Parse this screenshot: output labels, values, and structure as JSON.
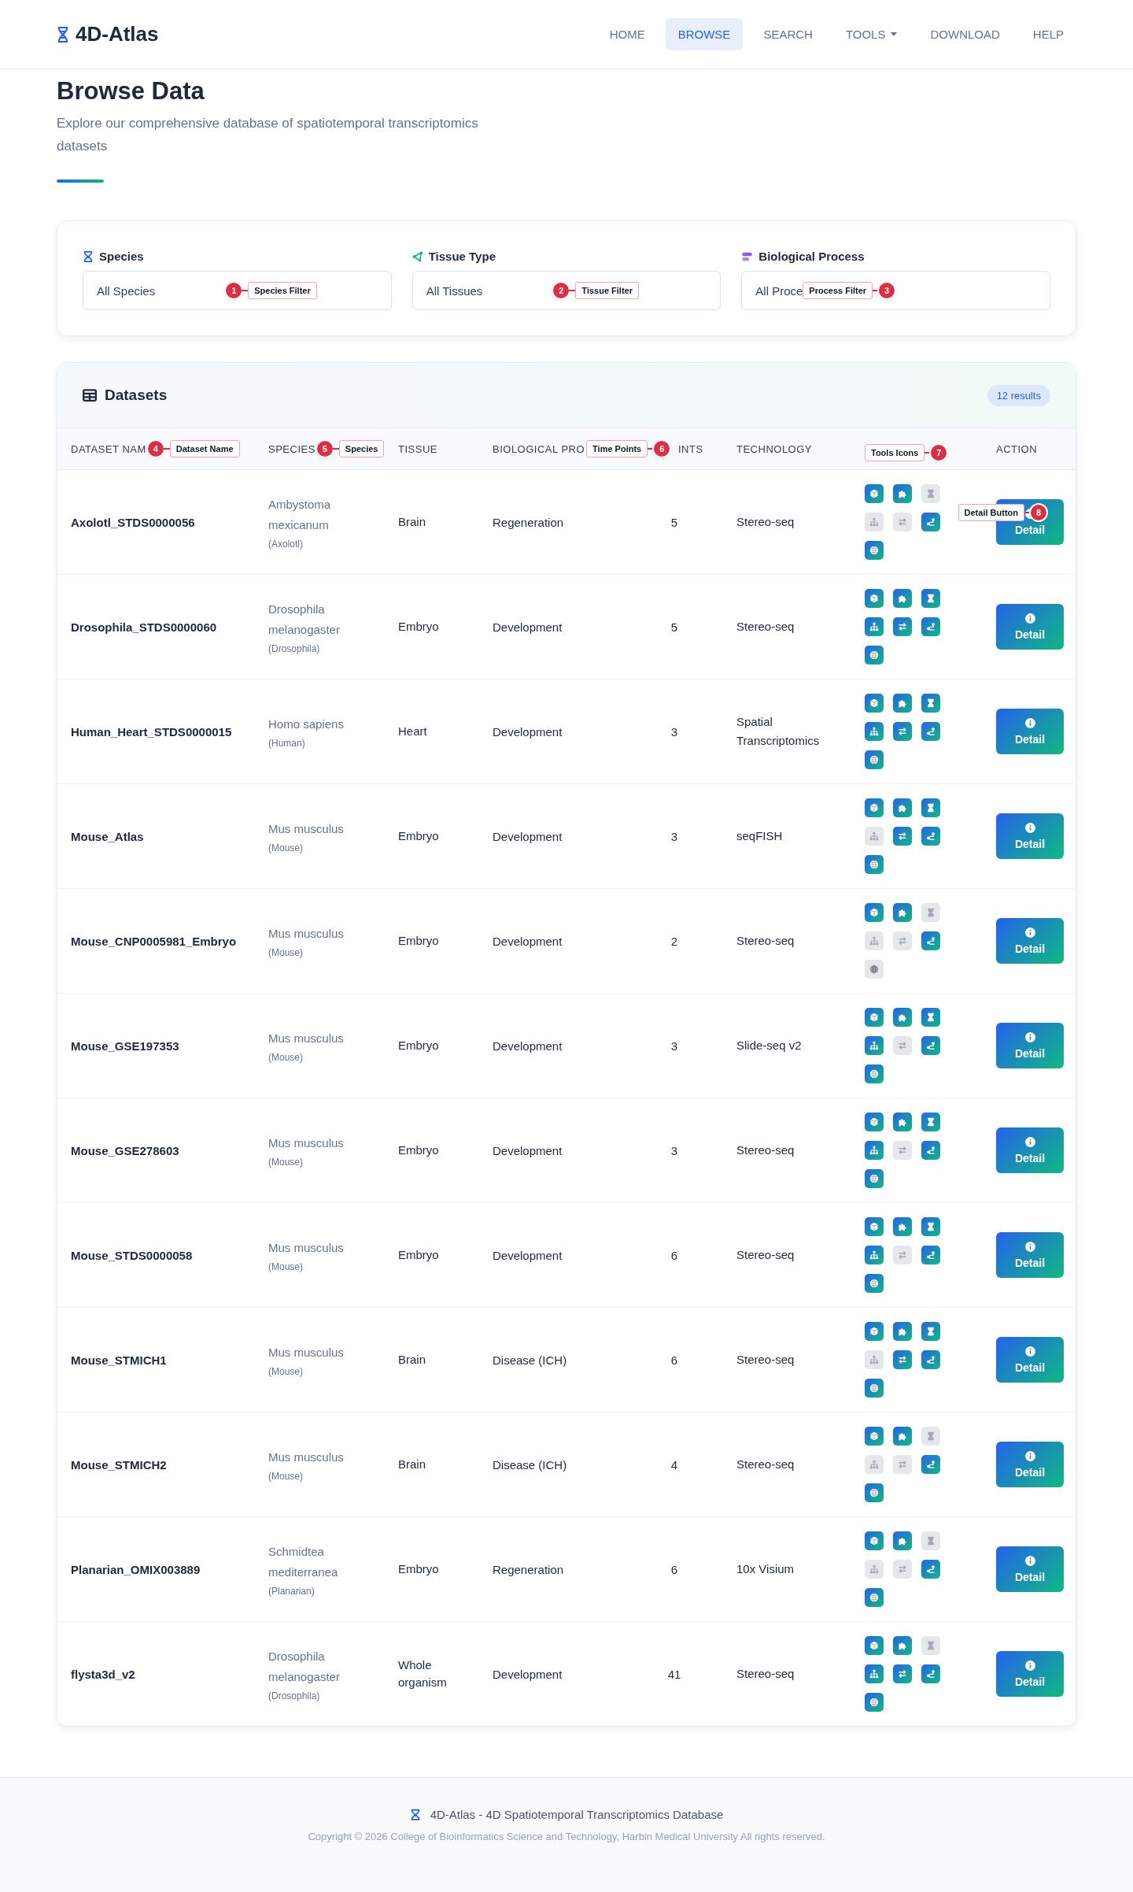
{
  "brand": "4D-Atlas",
  "nav": [
    {
      "label": "HOME",
      "selected": false,
      "dropdown": false
    },
    {
      "label": "BROWSE",
      "selected": true,
      "dropdown": false
    },
    {
      "label": "SEARCH",
      "selected": false,
      "dropdown": false
    },
    {
      "label": "TOOLS",
      "selected": false,
      "dropdown": true
    },
    {
      "label": "DOWNLOAD",
      "selected": false,
      "dropdown": false
    },
    {
      "label": "HELP",
      "selected": false,
      "dropdown": false
    }
  ],
  "page": {
    "title": "Browse Data",
    "subtitle": "Explore our comprehensive database of spatiotemporal transcriptomics datasets"
  },
  "filters": [
    {
      "label": "Species",
      "value": "All Species",
      "callout": {
        "number": "1",
        "label": "Species Filter",
        "kind": "badge-first"
      }
    },
    {
      "label": "Tissue Type",
      "value": "All Tissues",
      "callout": {
        "number": "2",
        "label": "Tissue Filter",
        "kind": "badge-first"
      }
    },
    {
      "label": "Biological Process",
      "value": "All Proce",
      "callout": {
        "number": "3",
        "label": "Process Filter",
        "kind": "label-first"
      }
    }
  ],
  "datasets": {
    "title": "Datasets",
    "count": "12 results",
    "columns": [
      {
        "label": "DATASET NAM",
        "callout": {
          "number": "4",
          "label": "Dataset Name",
          "kind": "badge-first"
        }
      },
      {
        "label": "SPECIES",
        "callout": {
          "number": "5",
          "label": "Species",
          "kind": "badge-first"
        }
      },
      {
        "label": "TISSUE"
      },
      {
        "label": "BIOLOGICAL PRO",
        "callout": {
          "number": "6",
          "label": "Time Points",
          "kind": "label-first"
        }
      },
      {
        "label": "INTS"
      },
      {
        "label": "TECHNOLOGY"
      },
      {
        "callout": {
          "number": "7",
          "label": "Tools Icons",
          "kind": "label-first"
        }
      },
      {
        "label": "ACTION"
      }
    ],
    "rows": [
      {
        "name": "Axolotl_STDS0000056",
        "species": "Ambystoma mexicanum",
        "common": "(Axolotl)",
        "tissue": "Brain",
        "process": "Regeneration",
        "time_points": "5",
        "technology": "Stereo-seq",
        "tools": [
          true,
          true,
          false,
          false,
          false,
          true,
          true
        ],
        "action": "Detail",
        "callout": {
          "number": "8",
          "label": "Detail Button",
          "kind": "label-first"
        }
      },
      {
        "name": "Drosophila_STDS0000060",
        "species": "Drosophila melanogaster",
        "common": "(Drosophila)",
        "tissue": "Embryo",
        "process": "Development",
        "time_points": "5",
        "technology": "Stereo-seq",
        "tools": [
          true,
          true,
          true,
          true,
          true,
          true,
          true
        ],
        "action": "Detail"
      },
      {
        "name": "Human_Heart_STDS0000015",
        "species": "Homo sapiens",
        "common": "(Human)",
        "tissue": "Heart",
        "process": "Development",
        "time_points": "3",
        "technology": "Spatial Transcriptomics",
        "tools": [
          true,
          true,
          true,
          true,
          true,
          true,
          true
        ],
        "action": "Detail"
      },
      {
        "name": "Mouse_Atlas",
        "species": "Mus musculus",
        "common": "(Mouse)",
        "tissue": "Embryo",
        "process": "Development",
        "time_points": "3",
        "technology": "seqFISH",
        "tools": [
          true,
          true,
          true,
          false,
          true,
          true,
          true
        ],
        "action": "Detail"
      },
      {
        "name": "Mouse_CNP0005981_Embryo",
        "species": "Mus musculus",
        "common": "(Mouse)",
        "tissue": "Embryo",
        "process": "Development",
        "time_points": "2",
        "technology": "Stereo-seq",
        "tools": [
          true,
          true,
          false,
          false,
          false,
          true,
          false
        ],
        "action": "Detail"
      },
      {
        "name": "Mouse_GSE197353",
        "species": "Mus musculus",
        "common": "(Mouse)",
        "tissue": "Embryo",
        "process": "Development",
        "time_points": "3",
        "technology": "Slide-seq v2",
        "tools": [
          true,
          true,
          true,
          true,
          false,
          true,
          true
        ],
        "action": "Detail"
      },
      {
        "name": "Mouse_GSE278603",
        "species": "Mus musculus",
        "common": "(Mouse)",
        "tissue": "Embryo",
        "process": "Development",
        "time_points": "3",
        "technology": "Stereo-seq",
        "tools": [
          true,
          true,
          true,
          true,
          false,
          true,
          true
        ],
        "action": "Detail"
      },
      {
        "name": "Mouse_STDS0000058",
        "species": "Mus musculus",
        "common": "(Mouse)",
        "tissue": "Embryo",
        "process": "Development",
        "time_points": "6",
        "technology": "Stereo-seq",
        "tools": [
          true,
          true,
          true,
          true,
          false,
          true,
          true
        ],
        "action": "Detail"
      },
      {
        "name": "Mouse_STMICH1",
        "species": "Mus musculus",
        "common": "(Mouse)",
        "tissue": "Brain",
        "process": "Disease (ICH)",
        "time_points": "6",
        "technology": "Stereo-seq",
        "tools": [
          true,
          true,
          true,
          false,
          true,
          true,
          true
        ],
        "action": "Detail"
      },
      {
        "name": "Mouse_STMICH2",
        "species": "Mus musculus",
        "common": "(Mouse)",
        "tissue": "Brain",
        "process": "Disease (ICH)",
        "time_points": "4",
        "technology": "Stereo-seq",
        "tools": [
          true,
          true,
          false,
          false,
          false,
          true,
          true
        ],
        "action": "Detail"
      },
      {
        "name": "Planarian_OMIX003889",
        "species": "Schmidtea mediterranea",
        "common": "(Planarian)",
        "tissue": "Embryo",
        "process": "Regeneration",
        "time_points": "6",
        "technology": "10x Visium",
        "tools": [
          true,
          true,
          false,
          false,
          false,
          true,
          true
        ],
        "action": "Detail"
      },
      {
        "name": "flysta3d_v2",
        "species": "Drosophila melanogaster",
        "common": "(Drosophila)",
        "tissue": "Whole organism",
        "process": "Development",
        "time_points": "41",
        "technology": "Stereo-seq",
        "tools": [
          true,
          true,
          false,
          true,
          true,
          true,
          true
        ],
        "action": "Detail"
      }
    ]
  },
  "footer": {
    "title": "4D-Atlas - 4D Spatiotemporal Transcriptomics Database",
    "copyright": "Copyright © 2026 College of Bioinformatics Science and Technology, Harbin Medical University All rights reserved."
  }
}
